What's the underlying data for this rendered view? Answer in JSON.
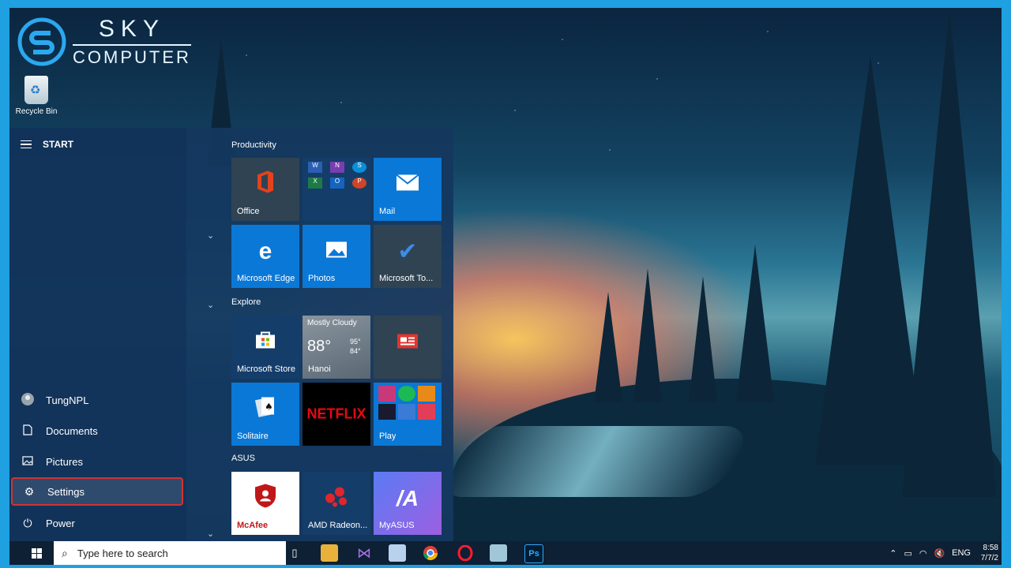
{
  "brand": {
    "line1": "SKY",
    "line2": "COMPUTER"
  },
  "desktop_icons": [
    {
      "label": "Recycle Bin",
      "icon": "recycle-bin-icon"
    }
  ],
  "start_menu": {
    "title": "START",
    "rail": [
      {
        "label": "TungNPL",
        "icon": "user-avatar-icon"
      },
      {
        "label": "Documents",
        "icon": "document-icon"
      },
      {
        "label": "Pictures",
        "icon": "pictures-icon"
      },
      {
        "label": "Settings",
        "icon": "gear-icon",
        "selected": true
      },
      {
        "label": "Power",
        "icon": "power-icon"
      }
    ],
    "groups": {
      "productivity": "Productivity",
      "explore": "Explore",
      "asus": "ASUS"
    },
    "tiles": {
      "office": "Office",
      "mail": "Mail",
      "edge": "Microsoft Edge",
      "photos": "Photos",
      "todo": "Microsoft To...",
      "store": "Microsoft Store",
      "weather_condition": "Mostly Cloudy",
      "weather_temp": "88°",
      "weather_high": "95°",
      "weather_low": "84°",
      "weather_city": "Hanoi",
      "solitaire": "Solitaire",
      "netflix": "NETFLIX",
      "play": "Play",
      "mcafee": "McAfee",
      "amd": "AMD Radeon...",
      "myasus": "MyASUS"
    }
  },
  "taskbar": {
    "search_placeholder": "Type here to search",
    "apps": [
      "task-view",
      "file-explorer",
      "visual-studio",
      "3d-viewer",
      "chrome",
      "opera",
      "notepad",
      "photoshop"
    ],
    "tray": {
      "language": "ENG",
      "time": "8:58",
      "date": "7/7/2"
    }
  },
  "colors": {
    "accent": "#0a78d7",
    "selection_border": "#d23232",
    "taskbar": "#0e2033"
  }
}
